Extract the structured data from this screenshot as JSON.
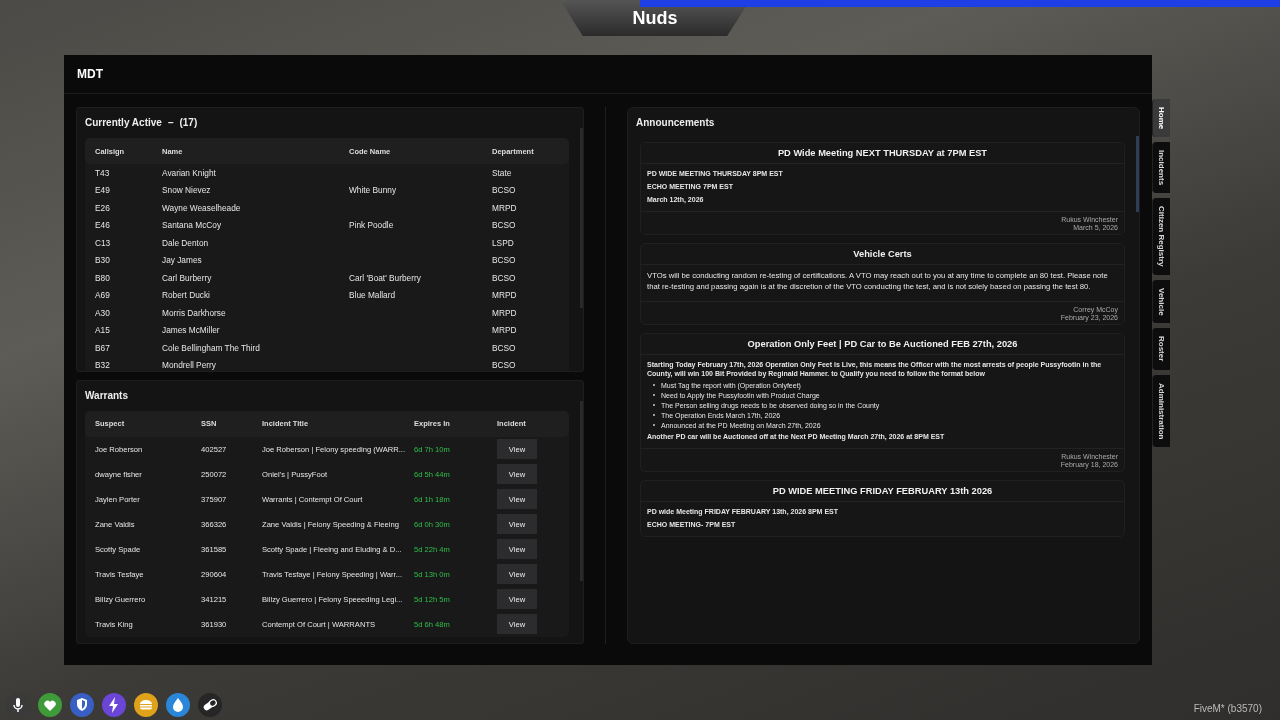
{
  "server_banner": {
    "name": "Nuds"
  },
  "window": {
    "title": "MDT"
  },
  "active_units": {
    "title": "Currently Active",
    "count": "(17)",
    "separator": "–",
    "columns": [
      "Callsign",
      "Name",
      "Code Name",
      "Department"
    ],
    "rows": [
      [
        "T43",
        "Avarian Knight",
        "",
        "State"
      ],
      [
        "E49",
        "Snow Nievez",
        "White Bunny",
        "BCSO"
      ],
      [
        "E26",
        "Wayne Weaselheade",
        "",
        "MRPD"
      ],
      [
        "E46",
        "Santana McCoy",
        "Pink Poodle",
        "BCSO"
      ],
      [
        "C13",
        "Dale Denton",
        "",
        "LSPD"
      ],
      [
        "B30",
        "Jay James",
        "",
        "BCSO"
      ],
      [
        "B80",
        "Carl Burberry",
        "Carl 'Boat' Burberry",
        "BCSO"
      ],
      [
        "A69",
        "Robert Ducki",
        "Blue Mallard",
        "MRPD"
      ],
      [
        "A30",
        "Morris Darkhorse",
        "",
        "MRPD"
      ],
      [
        "A15",
        "James McMiller",
        "",
        "MRPD"
      ],
      [
        "B67",
        "Cole Bellingham The Third",
        "",
        "BCSO"
      ],
      [
        "B32",
        "Mondrell Perry",
        "",
        "BCSO"
      ]
    ]
  },
  "warrants": {
    "title": "Warrants",
    "columns": [
      "Suspect",
      "SSN",
      "Incident Title",
      "Expires In",
      "Incident"
    ],
    "rows": [
      {
        "suspect": "Joe Roberson",
        "ssn": "402527",
        "incident_title": "Joe Roberson | Felony speeding (WARR...",
        "expires_in": "6d 7h 10m",
        "action": "View"
      },
      {
        "suspect": "dwayne fisher",
        "ssn": "250072",
        "incident_title": "Oniel's | PussyFoot",
        "expires_in": "6d 5h 44m",
        "action": "View"
      },
      {
        "suspect": "Jaylen Porter",
        "ssn": "375907",
        "incident_title": "Warrants | Contempt Of Court",
        "expires_in": "6d 1h 18m",
        "action": "View"
      },
      {
        "suspect": "Zane Valdis",
        "ssn": "366326",
        "incident_title": "Zane Valdis | Felony Speeding & Fleeing",
        "expires_in": "6d 0h 30m",
        "action": "View"
      },
      {
        "suspect": "Scotty Spade",
        "ssn": "361585",
        "incident_title": "Scotty Spade | Fleeing and Eluding & D...",
        "expires_in": "5d 22h 4m",
        "action": "View"
      },
      {
        "suspect": "Travis Tesfaye",
        "ssn": "290604",
        "incident_title": "Travis Tesfaye | Felony Speeding | Warr...",
        "expires_in": "5d 13h 0m",
        "action": "View"
      },
      {
        "suspect": "Billzy Guerrero",
        "ssn": "341215",
        "incident_title": "Billzy Guerrero | Felony Speeeding Legi...",
        "expires_in": "5d 12h 5m",
        "action": "View"
      },
      {
        "suspect": "Travis King",
        "ssn": "361930",
        "incident_title": "Contempt Of Court | WARRANTS",
        "expires_in": "5d 6h 48m",
        "action": "View"
      }
    ]
  },
  "announcements": {
    "title": "Announcements",
    "items": [
      {
        "title": "PD Wide Meeting NEXT THURSDAY at 7PM EST",
        "blocks": [
          {
            "kind": "p",
            "bold": true,
            "text": "PD WIDE MEETING THURSDAY 8PM EST"
          },
          {
            "kind": "p",
            "bold": true,
            "text": "ECHO MEETING 7PM EST"
          },
          {
            "kind": "p",
            "bold": true,
            "text": "March 12th, 2026"
          }
        ],
        "author": "Rukus Winchester",
        "date": "March 5, 2026"
      },
      {
        "title": "Vehicle Certs",
        "blocks": [
          {
            "kind": "lead",
            "bold": false,
            "text": "VTOs will be conducting random re-testing of certifications. A VTO may reach out to you at any time to complete an 80 test. Please note that re-testing and passing again is at the discretion of the VTO conducting the test, and is not solely based on passing the test 80."
          }
        ],
        "author": "Correy McCoy",
        "date": "February 23, 2026"
      },
      {
        "title": "Operation Only Feet | PD Car to Be Auctioned FEB 27th, 2026",
        "blocks": [
          {
            "kind": "p",
            "bold": true,
            "text": "Starting Today February 17th, 2026 Operation Only Feet is Live, this means the Officer with the most arrests of people Pussyfootin in the County, will win 100 Bit Provided by Reginald Hammer. to Qualify you need to follow the format below"
          },
          {
            "kind": "li",
            "bold": false,
            "text": "Must Tag the report with (Operation Onlyfeet)"
          },
          {
            "kind": "li",
            "bold": false,
            "text": "Need to Apply the Pussyfootin with Product Charge"
          },
          {
            "kind": "li",
            "bold": false,
            "text": "The Person selling drugs needs to be observed doing so in the County"
          },
          {
            "kind": "li",
            "bold": false,
            "text": "The Operation Ends March 17th, 2026"
          },
          {
            "kind": "li",
            "bold": false,
            "text": "Announced at the PD Meeting on March 27th, 2026"
          },
          {
            "kind": "p",
            "bold": true,
            "text": "Another PD car will be Auctioned off at the Next PD Meeting March 27th, 2026 at 8PM EST"
          }
        ],
        "author": "Rukus Winchester",
        "date": "February 18, 2026"
      },
      {
        "title": "PD WIDE MEETING FRIDAY FEBRUARY 13th 2026",
        "blocks": [
          {
            "kind": "p",
            "bold": true,
            "text": "PD wide Meeting FRIDAY FEBRUARY 13th, 2026 8PM EST"
          },
          {
            "kind": "p",
            "bold": true,
            "text": "ECHO MEETING- 7PM EST"
          }
        ]
      }
    ]
  },
  "side_tabs": [
    {
      "label": "Home",
      "selected": true
    },
    {
      "label": "Incidents",
      "selected": false
    },
    {
      "label": "Citizen Registry",
      "selected": false
    },
    {
      "label": "Vehicle",
      "selected": false
    },
    {
      "label": "Roster",
      "selected": false
    },
    {
      "label": "Administration",
      "selected": false
    }
  ],
  "status_icons": [
    {
      "kind": "mic",
      "color": "#3a3a3a"
    },
    {
      "kind": "heart",
      "color": "#3f9b3a"
    },
    {
      "kind": "shield",
      "color": "#3a5fc4"
    },
    {
      "kind": "bolt",
      "color": "#6a45d6"
    },
    {
      "kind": "burger",
      "color": "#e0a21b"
    },
    {
      "kind": "drop",
      "color": "#2a86d8"
    },
    {
      "kind": "pill",
      "color": "#262626"
    }
  ],
  "build_label": "FiveM* (b3570)"
}
